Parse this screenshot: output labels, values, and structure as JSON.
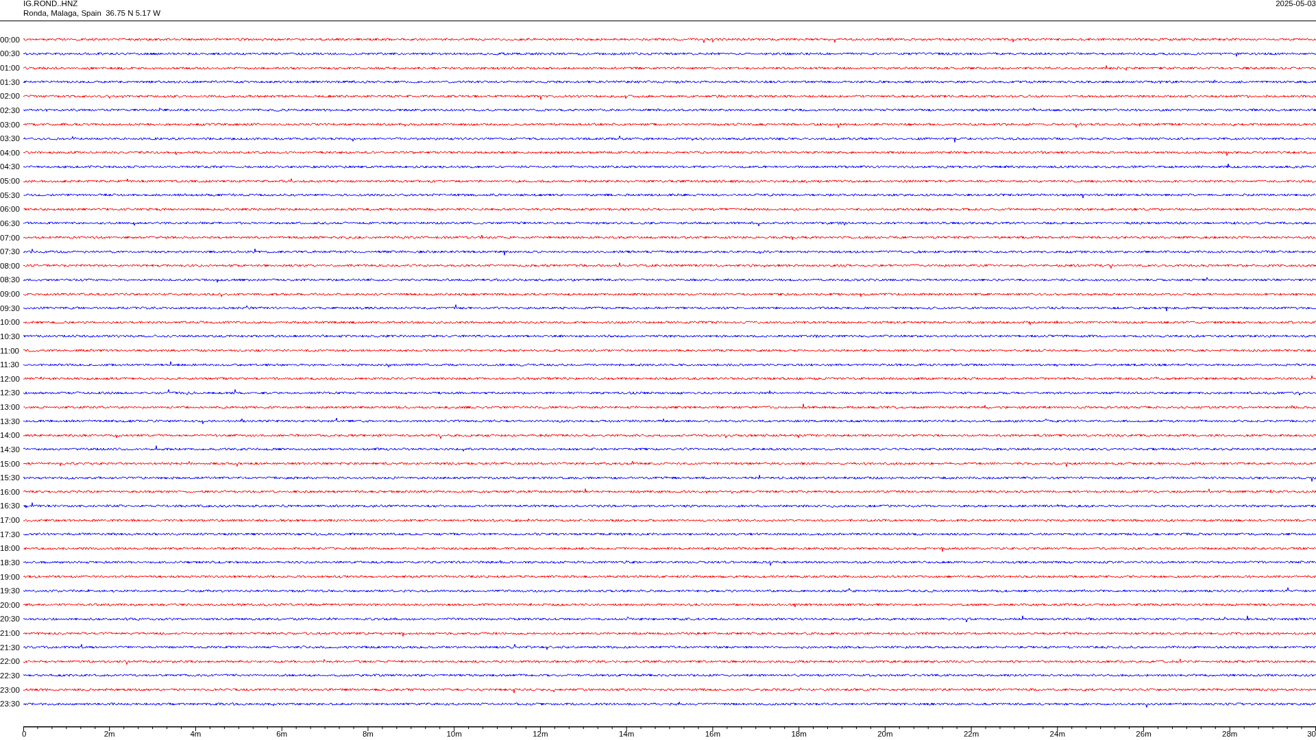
{
  "header": {
    "station": "IG.ROND..HNZ",
    "location": "Ronda, Malaga, Spain  36.75 N 5.17 W",
    "date": "2025-05-03"
  },
  "rows": [
    {
      "time": "00:00",
      "color": "#ff0000"
    },
    {
      "time": "00:30",
      "color": "#0000ff"
    },
    {
      "time": "01:00",
      "color": "#ff0000"
    },
    {
      "time": "01:30",
      "color": "#0000ff"
    },
    {
      "time": "02:00",
      "color": "#ff0000"
    },
    {
      "time": "02:30",
      "color": "#0000ff"
    },
    {
      "time": "03:00",
      "color": "#ff0000"
    },
    {
      "time": "03:30",
      "color": "#0000ff"
    },
    {
      "time": "04:00",
      "color": "#ff0000"
    },
    {
      "time": "04:30",
      "color": "#0000ff"
    },
    {
      "time": "05:00",
      "color": "#ff0000"
    },
    {
      "time": "05:30",
      "color": "#0000ff"
    },
    {
      "time": "06:00",
      "color": "#ff0000"
    },
    {
      "time": "06:30",
      "color": "#0000ff"
    },
    {
      "time": "07:00",
      "color": "#ff0000"
    },
    {
      "time": "07:30",
      "color": "#0000ff"
    },
    {
      "time": "08:00",
      "color": "#ff0000"
    },
    {
      "time": "08:30",
      "color": "#0000ff"
    },
    {
      "time": "09:00",
      "color": "#ff0000"
    },
    {
      "time": "09:30",
      "color": "#0000ff"
    },
    {
      "time": "10:00",
      "color": "#ff0000"
    },
    {
      "time": "10:30",
      "color": "#0000ff"
    },
    {
      "time": "11:00",
      "color": "#ff0000"
    },
    {
      "time": "11:30",
      "color": "#0000ff"
    },
    {
      "time": "12:00",
      "color": "#ff0000"
    },
    {
      "time": "12:30",
      "color": "#0000ff"
    },
    {
      "time": "13:00",
      "color": "#ff0000"
    },
    {
      "time": "13:30",
      "color": "#0000ff"
    },
    {
      "time": "14:00",
      "color": "#ff0000"
    },
    {
      "time": "14:30",
      "color": "#0000ff"
    },
    {
      "time": "15:00",
      "color": "#ff0000"
    },
    {
      "time": "15:30",
      "color": "#0000ff"
    },
    {
      "time": "16:00",
      "color": "#ff0000"
    },
    {
      "time": "16:30",
      "color": "#0000ff"
    },
    {
      "time": "17:00",
      "color": "#ff0000"
    },
    {
      "time": "17:30",
      "color": "#0000ff"
    },
    {
      "time": "18:00",
      "color": "#ff0000"
    },
    {
      "time": "18:30",
      "color": "#0000ff"
    },
    {
      "time": "19:00",
      "color": "#ff0000"
    },
    {
      "time": "19:30",
      "color": "#0000ff"
    },
    {
      "time": "20:00",
      "color": "#ff0000"
    },
    {
      "time": "20:30",
      "color": "#0000ff"
    },
    {
      "time": "21:00",
      "color": "#ff0000"
    },
    {
      "time": "21:30",
      "color": "#0000ff"
    },
    {
      "time": "22:00",
      "color": "#ff0000"
    },
    {
      "time": "22:30",
      "color": "#0000ff"
    },
    {
      "time": "23:00",
      "color": "#ff0000"
    },
    {
      "time": "23:30",
      "color": "#0000ff"
    }
  ],
  "x_axis": {
    "tick_labels": [
      "0",
      "2m",
      "4m",
      "6m",
      "8m",
      "10m",
      "12m",
      "14m",
      "16m",
      "18m",
      "20m",
      "22m",
      "24m",
      "26m",
      "28m",
      "30"
    ]
  }
}
